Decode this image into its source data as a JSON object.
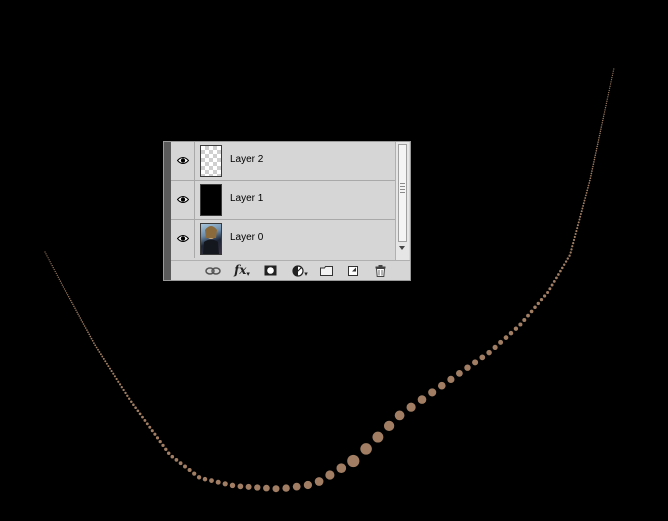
{
  "canvas": {
    "background": "#000000",
    "stroke_color": "#a17e63"
  },
  "layers_panel": {
    "layers": [
      {
        "name": "Layer 2",
        "thumbnail": "transparent",
        "visible": true
      },
      {
        "name": "Layer 1",
        "thumbnail": "black-fill",
        "visible": true
      },
      {
        "name": "Layer 0",
        "thumbnail": "photo",
        "visible": true
      }
    ],
    "footer_tools": [
      "link-layers-icon",
      "fx-icon",
      "layer-mask-icon",
      "adjustment-layer-icon",
      "new-group-icon",
      "new-layer-icon",
      "trash-icon"
    ],
    "fx_label": "fx"
  }
}
